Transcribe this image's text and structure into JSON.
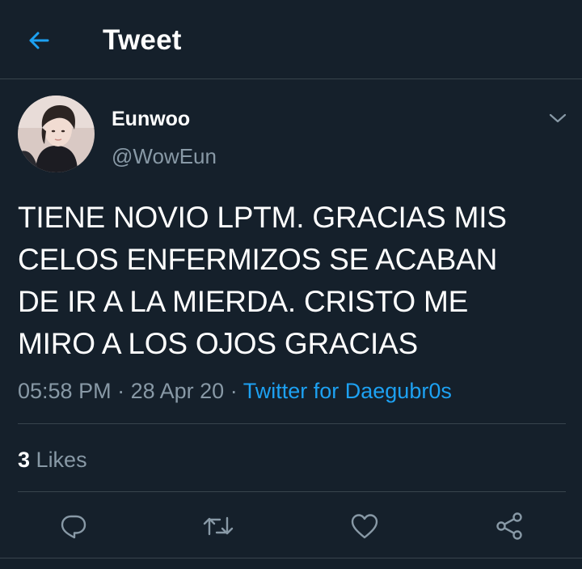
{
  "header": {
    "title": "Tweet",
    "back_icon": "arrow-left-icon"
  },
  "author": {
    "display_name": "Eunwoo",
    "handle": "@WowEun",
    "avatar": "profile-photo",
    "menu_icon": "chevron-down-icon"
  },
  "tweet": {
    "text": "TIENE NOVIO LPTM. GRACIAS MIS\nCELOS ENFERMIZOS SE ACABAN\nDE IR A LA MIERDA. CRISTO ME\nMIRO A LOS OJOS GRACIAS",
    "time": "05:58 PM",
    "separator": "·",
    "date": "28 Apr 20",
    "source": "Twitter for Daegubr0s"
  },
  "stats": {
    "likes_count": "3",
    "likes_label": "Likes"
  },
  "actions": {
    "reply_icon": "reply-icon",
    "retweet_icon": "retweet-icon",
    "like_icon": "heart-icon",
    "share_icon": "share-icon"
  },
  "colors": {
    "background": "#15202b",
    "accent": "#1da1f2",
    "secondary_text": "#8899a6",
    "divider": "#38444d"
  }
}
